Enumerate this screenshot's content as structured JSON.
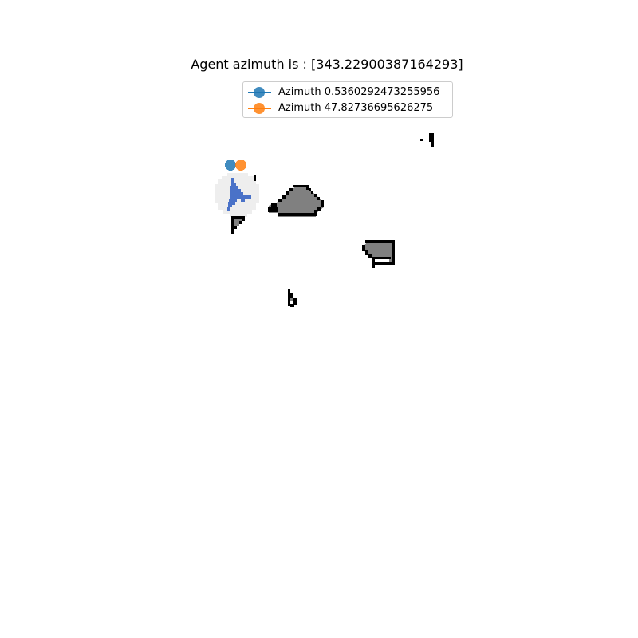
{
  "title": "Agent azimuth is : [343.22900387164293]",
  "legend": {
    "items": [
      {
        "label": "Azimuth 0.5360292473255956",
        "color": "#1f77b4"
      },
      {
        "label": "Azimuth 47.82736695626275",
        "color": "#ff7f0e"
      }
    ]
  },
  "map": {
    "agent_color": "#4a72c8",
    "agent_halo_color": "#e8e8e8",
    "obstacle_fill": "#808080",
    "obstacle_edge": "#000000"
  }
}
